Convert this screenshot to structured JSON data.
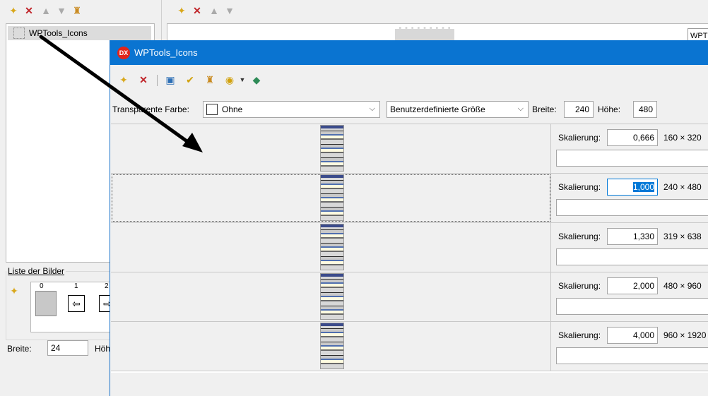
{
  "background_window": {
    "left_toolbar_icons": [
      "new-icon",
      "delete-icon",
      "move-up-icon",
      "move-down-icon",
      "clear-icon"
    ],
    "top_toolbar_icons": [
      "new-icon",
      "delete-icon",
      "move-up-icon",
      "move-down-icon"
    ],
    "tree_item_label": "WPTools_Icons",
    "right_field_text": "WPT",
    "images_group_label": "Liste der Bilder",
    "thumb_indices": [
      "0",
      "1",
      "2"
    ],
    "width_label": "Breite:",
    "width_value": "24",
    "height_label_partial": "Höh"
  },
  "dialog": {
    "title": "WPTools_Icons",
    "logo_text": "DX",
    "toolbar_icons": [
      "new-icon",
      "delete-icon",
      "image-icon",
      "check-icon",
      "clear-icon",
      "zoom-icon",
      "dropdown-icon",
      "book-icon"
    ],
    "transparent_label": "Transparente Farbe:",
    "transparent_value": "Ohne",
    "size_mode": "Benutzerdefinierte Größe",
    "width_label": "Breite:",
    "width_value": "240",
    "height_label": "Höhe:",
    "height_value": "480",
    "rows": [
      {
        "scale_label": "Skalierung:",
        "scale": "0,666",
        "dims": "160 × 320",
        "selected": false
      },
      {
        "scale_label": "Skalierung:",
        "scale": "1,000",
        "dims": "240 × 480",
        "selected": true
      },
      {
        "scale_label": "Skalierung:",
        "scale": "1,330",
        "dims": "319 × 638",
        "selected": false
      },
      {
        "scale_label": "Skalierung:",
        "scale": "2,000",
        "dims": "480 × 960",
        "selected": false
      },
      {
        "scale_label": "Skalierung:",
        "scale": "4,000",
        "dims": "960 × 1920",
        "selected": false
      }
    ]
  },
  "colors": {
    "titlebar": "#0a74d1",
    "selection": "#0078d7",
    "arrow": "#000000"
  }
}
